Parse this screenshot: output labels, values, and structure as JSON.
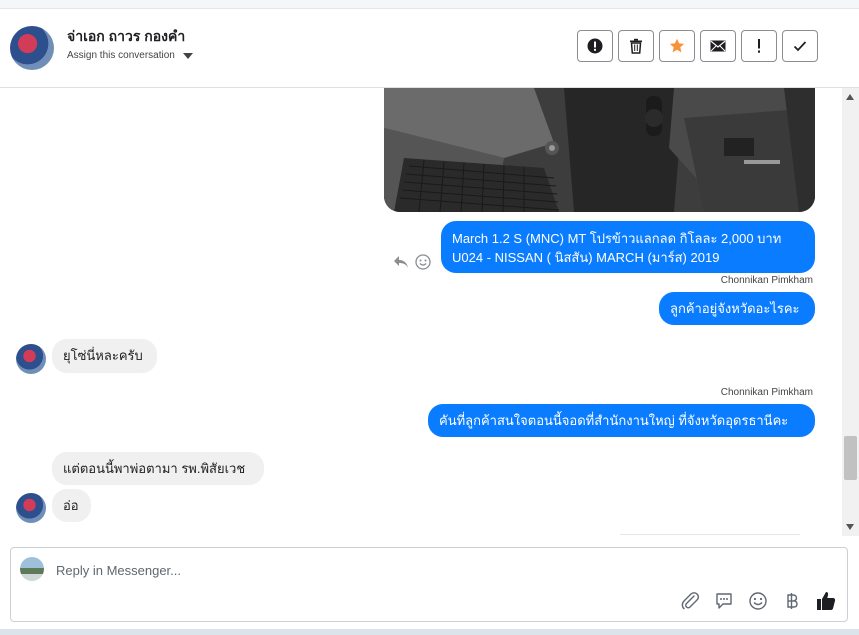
{
  "header": {
    "contact_name": "จ่าเอก ถาวร กองคำ",
    "assign_label": "Assign this conversation"
  },
  "toolbar": {
    "buttons": [
      "alert-circle-icon",
      "trash-icon",
      "star-icon",
      "envelope-icon",
      "exclamation-icon",
      "check-icon"
    ],
    "star_color": "#f7923b"
  },
  "messages": {
    "out_1_line1": "March 1.2 S (MNC) MT โปรข้าวแลกลด กิโลละ 2,000 บาท",
    "out_1_line2": "U024 - NISSAN ( นิสสัน) MARCH (มาร์ส) 2019",
    "sender_1": "Chonnikan Pimkham",
    "out_2": "ลูกค้าอยู่จังหวัดอะไรคะ",
    "in_1": "ยุโซ่นี่หละครับ",
    "sender_2": "Chonnikan Pimkham",
    "out_3": "คันที่ลูกค้าสนใจตอนนี้จอดที่สำนักงานใหญ่ ที่จังหวัดอุดรธานีคะ",
    "in_2": "แต่ตอนนี้พาพ่อตามา รพ.พิสัยเวช",
    "in_3": "อ่อ"
  },
  "composer": {
    "placeholder": "Reply in Messenger...",
    "icons": [
      "paperclip-icon",
      "quick-reply-icon",
      "emoji-icon",
      "baht-icon",
      "thumbs-up-icon"
    ]
  },
  "colors": {
    "accent": "#0a7cff",
    "incoming_bubble": "#f0f0f0"
  }
}
